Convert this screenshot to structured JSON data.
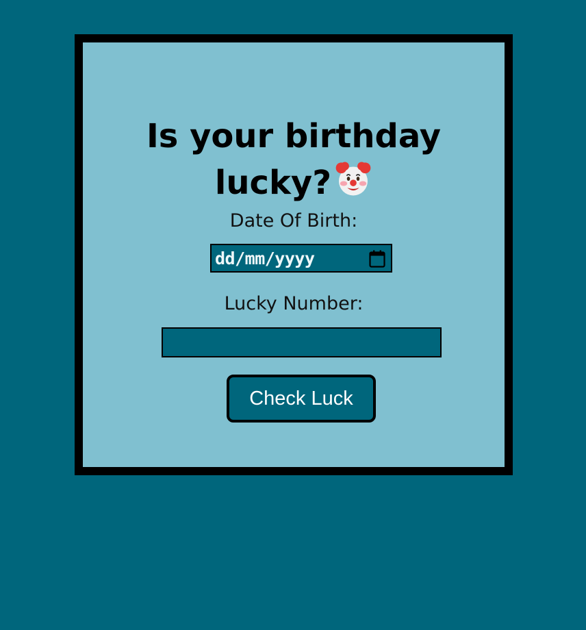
{
  "title": {
    "line1": "Is your birthday",
    "line2": "lucky?",
    "emoji_icon": "clown-face-icon"
  },
  "form": {
    "dob_label": "Date Of Birth:",
    "dob_placeholder": "dd/mm/yyyy",
    "lucky_label": "Lucky Number:",
    "lucky_value": "",
    "submit_label": "Check Luck"
  },
  "colors": {
    "page_background": "#00667c",
    "card_background": "#80c0d0",
    "border": "#000000",
    "input_background": "#00667c",
    "button_text": "#ffffff"
  }
}
